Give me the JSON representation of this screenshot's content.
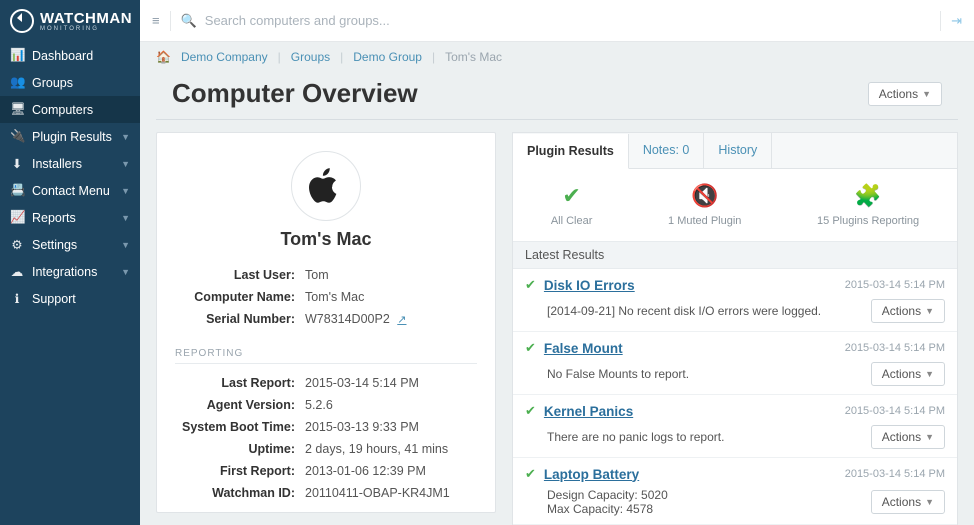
{
  "brand": {
    "name": "WATCHMAN",
    "sub": "MONITORING"
  },
  "search": {
    "placeholder": "Search computers and groups..."
  },
  "sidebar": {
    "items": [
      {
        "label": "Dashboard",
        "icon": "📊",
        "expandable": false
      },
      {
        "label": "Groups",
        "icon": "👥",
        "expandable": false
      },
      {
        "label": "Computers",
        "icon": "🖥",
        "expandable": false,
        "active": true
      },
      {
        "label": "Plugin Results",
        "icon": "🔌",
        "expandable": true
      },
      {
        "label": "Installers",
        "icon": "⬇",
        "expandable": true
      },
      {
        "label": "Contact Menu",
        "icon": "📇",
        "expandable": true
      },
      {
        "label": "Reports",
        "icon": "📈",
        "expandable": true
      },
      {
        "label": "Settings",
        "icon": "⚙",
        "expandable": true
      },
      {
        "label": "Integrations",
        "icon": "☁",
        "expandable": true
      },
      {
        "label": "Support",
        "icon": "ℹ",
        "expandable": false
      }
    ]
  },
  "breadcrumbs": {
    "items": [
      "Demo Company",
      "Groups",
      "Demo Group",
      "Tom's Mac"
    ]
  },
  "page": {
    "title": "Computer Overview",
    "actions_label": "Actions"
  },
  "overview": {
    "computer_name": "Tom's Mac",
    "kv1": [
      {
        "k": "Last User:",
        "v": "Tom"
      },
      {
        "k": "Computer Name:",
        "v": "Tom's Mac"
      },
      {
        "k": "Serial Number:",
        "v": "W78314D00P2",
        "link": true
      }
    ],
    "section2": "REPORTING",
    "kv2": [
      {
        "k": "Last Report:",
        "v": "2015-03-14 5:14 PM"
      },
      {
        "k": "Agent Version:",
        "v": "5.2.6"
      },
      {
        "k": "System Boot Time:",
        "v": "2015-03-13 9:33 PM"
      },
      {
        "k": "Uptime:",
        "v": "2 days, 19 hours, 41 mins"
      },
      {
        "k": "First Report:",
        "v": "2013-01-06 12:39 PM"
      },
      {
        "k": "Watchman ID:",
        "v": "20110411-OBAP-KR4JM1"
      }
    ]
  },
  "tabs": {
    "items": [
      {
        "label": "Plugin Results",
        "active": true
      },
      {
        "label": "Notes: 0"
      },
      {
        "label": "History"
      }
    ]
  },
  "status": {
    "items": [
      {
        "label": "All Clear",
        "cls": "green",
        "glyph": "✔"
      },
      {
        "label": "1 Muted Plugin",
        "cls": "gray",
        "glyph": "🔇"
      },
      {
        "label": "15 Plugins Reporting",
        "cls": "blue",
        "glyph": "🧩"
      }
    ]
  },
  "latest_results": {
    "title": "Latest Results",
    "items": [
      {
        "name": "Disk IO Errors",
        "ts": "2015-03-14 5:14 PM",
        "msg": "[2014-09-21] No recent disk I/O errors were logged."
      },
      {
        "name": "False Mount",
        "ts": "2015-03-14 5:14 PM",
        "msg": "No False Mounts to report."
      },
      {
        "name": "Kernel Panics",
        "ts": "2015-03-14 5:14 PM",
        "msg": "There are no panic logs to report."
      },
      {
        "name": "Laptop Battery",
        "ts": "2015-03-14 5:14 PM",
        "msg": "Design Capacity: 5020\nMax Capacity: 4578"
      }
    ],
    "actions_label": "Actions"
  }
}
